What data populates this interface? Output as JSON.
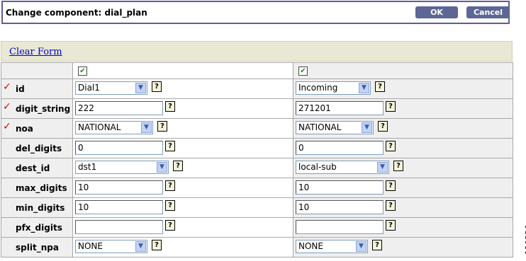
{
  "header": {
    "title": "Change component: dial_plan",
    "ok_label": "OK",
    "cancel_label": "Cancel"
  },
  "form": {
    "clear_label": "Clear Form"
  },
  "columns": [
    {
      "checked": true
    },
    {
      "checked": true
    }
  ],
  "rows": [
    {
      "label": "id",
      "required": true,
      "type": "select",
      "values": [
        "Dial1",
        "Incoming"
      ]
    },
    {
      "label": "digit_string",
      "required": true,
      "type": "input",
      "values": [
        "222",
        "271201"
      ]
    },
    {
      "label": "noa",
      "required": true,
      "type": "select",
      "values": [
        "NATIONAL",
        "NATIONAL"
      ]
    },
    {
      "label": "del_digits",
      "required": false,
      "type": "input",
      "values": [
        "0",
        "0"
      ]
    },
    {
      "label": "dest_id",
      "required": false,
      "type": "select",
      "values": [
        "dst1",
        "local-sub"
      ]
    },
    {
      "label": "max_digits",
      "required": false,
      "type": "input",
      "values": [
        "10",
        "10"
      ]
    },
    {
      "label": "min_digits",
      "required": false,
      "type": "input",
      "values": [
        "10",
        "10"
      ]
    },
    {
      "label": "pfx_digits",
      "required": false,
      "type": "input",
      "values": [
        "",
        ""
      ]
    },
    {
      "label": "split_npa",
      "required": false,
      "type": "select",
      "values": [
        "NONE",
        "NONE"
      ]
    }
  ],
  "figure_id": "120326",
  "icons": {
    "required": "check-mark-icon",
    "help": "help-icon",
    "dropdown": "chevron-down-icon"
  },
  "colors": {
    "title_border": "#5d5d98",
    "button": "#5e6695",
    "clear_bar": "#e8e8d4",
    "required_mark": "#c01010"
  }
}
